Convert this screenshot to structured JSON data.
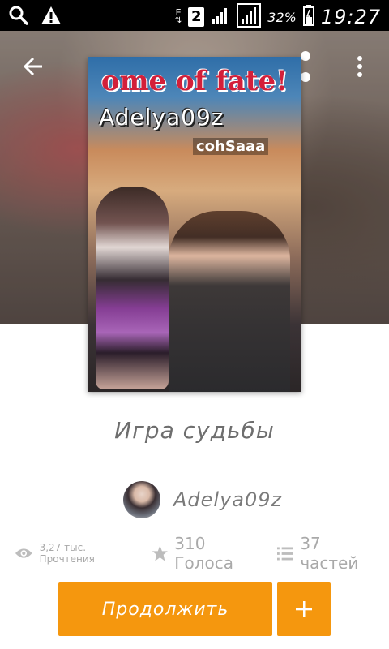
{
  "status_bar": {
    "network_type": "E",
    "sim_slot": "2",
    "battery_percent": "32%",
    "time": "19:27",
    "icons": [
      "search-icon",
      "warning-icon",
      "data-arrows-icon",
      "sim-2-icon",
      "signal-icon",
      "signal-boxed-icon",
      "battery-icon"
    ]
  },
  "toolbar": {
    "icons": [
      "back-arrow-icon",
      "share-icon",
      "more-vertical-icon"
    ]
  },
  "cover": {
    "banner_text": "ome of fate!",
    "author_text": "Adelya09z",
    "subtitle_text": "cohSaaa"
  },
  "story": {
    "title": "Игра судьбы",
    "author": "Adelya09z"
  },
  "stats": {
    "reads": "3,27 тыс. Прочтения",
    "votes": "310 Голоса",
    "parts": "37 частей"
  },
  "actions": {
    "continue_label": "Продолжить",
    "add_label": "+"
  },
  "colors": {
    "accent": "#f5970e",
    "status_bar_bg": "#000000",
    "text_muted": "#a9a9a9",
    "title_text": "#6e6e6e"
  }
}
